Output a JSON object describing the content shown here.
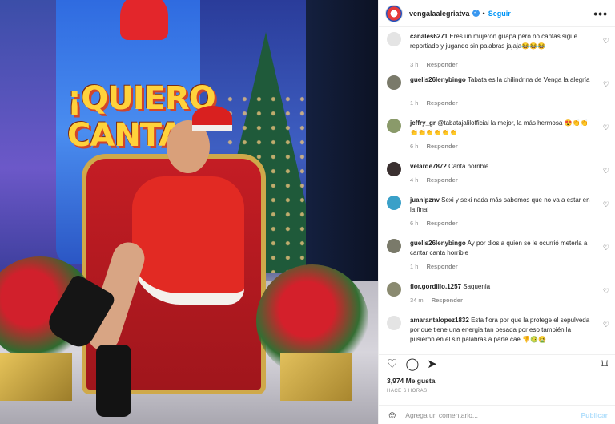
{
  "post": {
    "username": "vengalaalegriatva",
    "follow_label": "Seguir",
    "more_label": "•••",
    "verified_mark": "✓",
    "dot": "•"
  },
  "photo": {
    "sign_text_1": "¡QUIERO",
    "sign_text_2": "CANTA"
  },
  "comments": [
    {
      "user": "canales6271",
      "text": "Eres un mujeron guapa pero no cantas sigue reportiado y jugando sin palabras jajaja😂😂😂",
      "time": "3 h",
      "reply_label": "Responder",
      "avatar_color": "#e4e4e4"
    },
    {
      "user": "guelis26lenybingo",
      "text": "Tabata es la chilindrina de Venga la alegría",
      "time": "1 h",
      "reply_label": "Responder",
      "avatar_color": "#7a7a6a"
    },
    {
      "user": "jeffry_gr",
      "text": "@tabatajalilofficial la mejor, la más hermosa 😍👏👏👏👏👏👏👏👏",
      "time": "6 h",
      "reply_label": "Responder",
      "avatar_color": "#8a9a6a"
    },
    {
      "user": "velarde7872",
      "text": "Canta horrible",
      "time": "4 h",
      "reply_label": "Responder",
      "avatar_color": "#3a3030"
    },
    {
      "user": "juanlpznv",
      "text": "Sexi y sexi nada más sabemos que no va a estar en la final",
      "time": "6 h",
      "reply_label": "Responder",
      "avatar_color": "#3aa0c8"
    },
    {
      "user": "guelis26lenybingo",
      "text": "Ay por dios a quien se le ocurrió meterla a cantar canta horrible",
      "time": "1 h",
      "reply_label": "Responder",
      "avatar_color": "#7a7a6a"
    },
    {
      "user": "flor.gordillo.1257",
      "text": "Saquenla",
      "time": "34 m",
      "reply_label": "Responder",
      "avatar_color": "#8a8a70"
    },
    {
      "user": "amarantalopez1832",
      "text": "Esta flora por que la protege el sepulveda por que tiene una energia tan pesada por eso también la pusieron en el sin palabras a parte cae 👎🤢🤮",
      "time": "",
      "reply_label": "",
      "avatar_color": "#e4e4e4"
    }
  ],
  "heart_icon": "♡",
  "actions": {
    "like_icon": "♡",
    "comment_icon": "◯",
    "share_icon": "➤",
    "save_icon": "⌑"
  },
  "likes": "3,974 Me gusta",
  "time_ago": "HACE 6 HORAS",
  "add_comment": {
    "emoji_icon": "☺",
    "placeholder": "Agrega un comentario...",
    "post_label": "Publicar"
  }
}
